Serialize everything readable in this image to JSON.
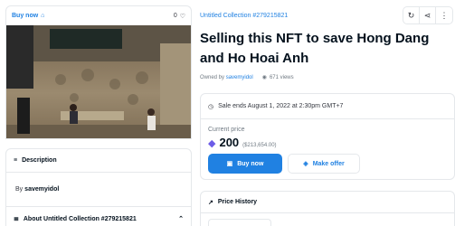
{
  "left": {
    "buy_now_label": "Buy now",
    "favorites_count": "0",
    "description_label": "Description",
    "by_prefix": "By",
    "creator": "savemyidol",
    "about_label": "About Untitled Collection #279215821"
  },
  "right": {
    "collection_name": "Untitled Collection #279215821",
    "title": "Selling this NFT to save Hong Dang and Ho Hoai Anh",
    "owned_by_prefix": "Owned by",
    "owner": "savemyidol",
    "views": "671 views",
    "sale_ends": "Sale ends August 1, 2022 at 2:30pm GMT+7",
    "current_price_label": "Current price",
    "price": "200",
    "price_usd": "($213,654.00)",
    "buy_now_button": "Buy now",
    "make_offer_button": "Make offer",
    "price_history_label": "Price History"
  },
  "colors": {
    "accent": "#2081e2",
    "border": "#e5e8eb",
    "text": "#04111d",
    "muted": "#707a83"
  },
  "icons": [
    "tag-icon",
    "heart-icon",
    "description-icon",
    "about-icon",
    "chevron-up-icon",
    "refresh-icon",
    "share-icon",
    "more-icon",
    "eye-icon",
    "clock-icon",
    "ethereum-icon",
    "wallet-icon",
    "offer-tag-icon",
    "trend-icon"
  ]
}
